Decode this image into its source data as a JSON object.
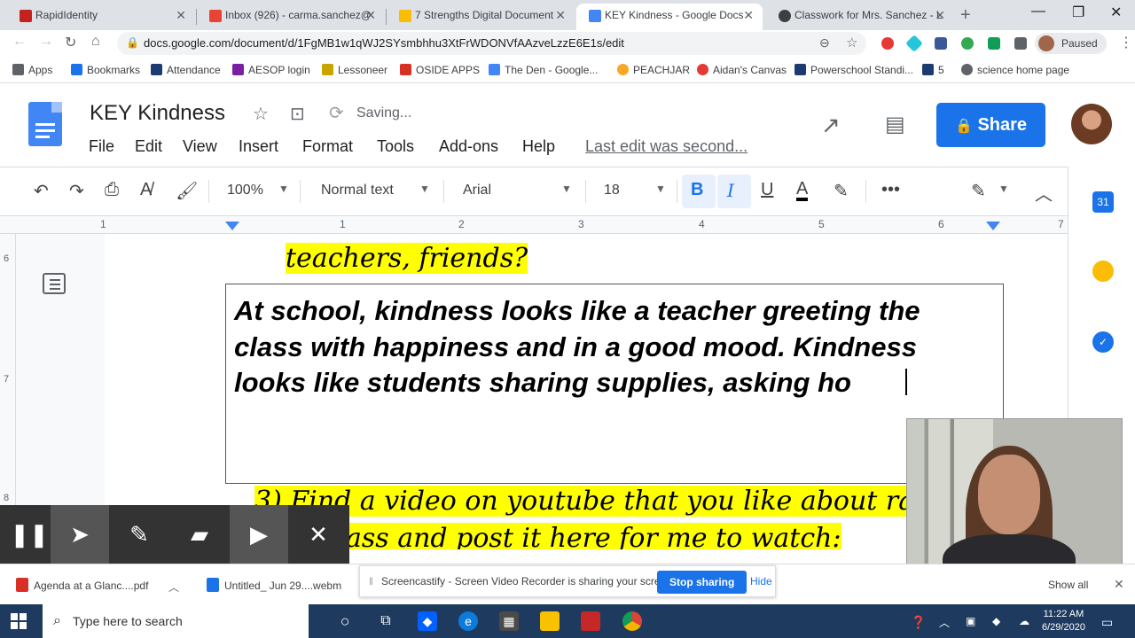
{
  "browser": {
    "tabs": [
      {
        "title": "RapidIdentity",
        "color": "#c5221f"
      },
      {
        "title": "Inbox (926) - carma.sanchez@",
        "color": "#ea4335"
      },
      {
        "title": "7 Strengths Digital Document",
        "color": "#fbbc04"
      },
      {
        "title": "KEY Kindness - Google Docs",
        "color": "#4285f4"
      },
      {
        "title": "Classwork for Mrs. Sanchez - L",
        "color": "#3c4043"
      }
    ],
    "url": "docs.google.com/document/d/1FgMB1w1qWJ2SYsmbhhu3XtFrWDONVfAAzveLzzE6E1s/edit",
    "profile_status": "Paused",
    "bookmarks": [
      {
        "label": "Apps",
        "color": "#5f6368"
      },
      {
        "label": "Bookmarks",
        "color": "#1a73e8"
      },
      {
        "label": "Attendance",
        "color": "#1c3b70"
      },
      {
        "label": "AESOP login",
        "color": "#7b1fa2"
      },
      {
        "label": "Lessoneer",
        "color": "#c9a400"
      },
      {
        "label": "OSIDE APPS",
        "color": "#d93025"
      },
      {
        "label": "The Den - Google...",
        "color": "#4285f4"
      },
      {
        "label": "PEACHJAR",
        "color": "#f9a825"
      },
      {
        "label": "Aidan's Canvas",
        "color": "#e53935"
      },
      {
        "label": "Powerschool Standi...",
        "color": "#1c3b70"
      },
      {
        "label": "5",
        "color": "#1c3b70"
      },
      {
        "label": "science home page",
        "color": "#5f6368"
      }
    ]
  },
  "docs": {
    "title": "KEY Kindness",
    "status": "Saving...",
    "menu": [
      "File",
      "Edit",
      "View",
      "Insert",
      "Format",
      "Tools",
      "Add-ons",
      "Help"
    ],
    "last_edit": "Last edit was second...",
    "share_label": "Share",
    "toolbar": {
      "zoom": "100%",
      "style": "Normal text",
      "font": "Arial",
      "size": "18"
    },
    "ruler_numbers": [
      "1",
      "1",
      "2",
      "3",
      "4",
      "5",
      "6",
      "7"
    ],
    "vruler_numbers": [
      "6",
      "7",
      "8"
    ]
  },
  "document": {
    "prev_question_tail": "teachers, friends?",
    "answer_lines": [
      "At school, kindness looks like a teacher greeting the",
      "class with happiness and in a good mood. Kindness",
      "looks like students sharing supplies, asking ho"
    ],
    "next_question_line1": "3) Find a video on youtube that you like about random a",
    "next_question_line2": "ass and post it here for me to watch:"
  },
  "downloads": {
    "items": [
      "Agenda at a Glanc....pdf",
      "Untitled_ Jun 29....webm"
    ],
    "sharing_text": "Screencastify - Screen Video Recorder is sharing your screen.",
    "stop_label": "Stop sharing",
    "hide_label": "Hide",
    "show_all": "Show all"
  },
  "taskbar": {
    "search_placeholder": "Type here to search",
    "time": "11:22 AM",
    "date": "6/29/2020"
  }
}
